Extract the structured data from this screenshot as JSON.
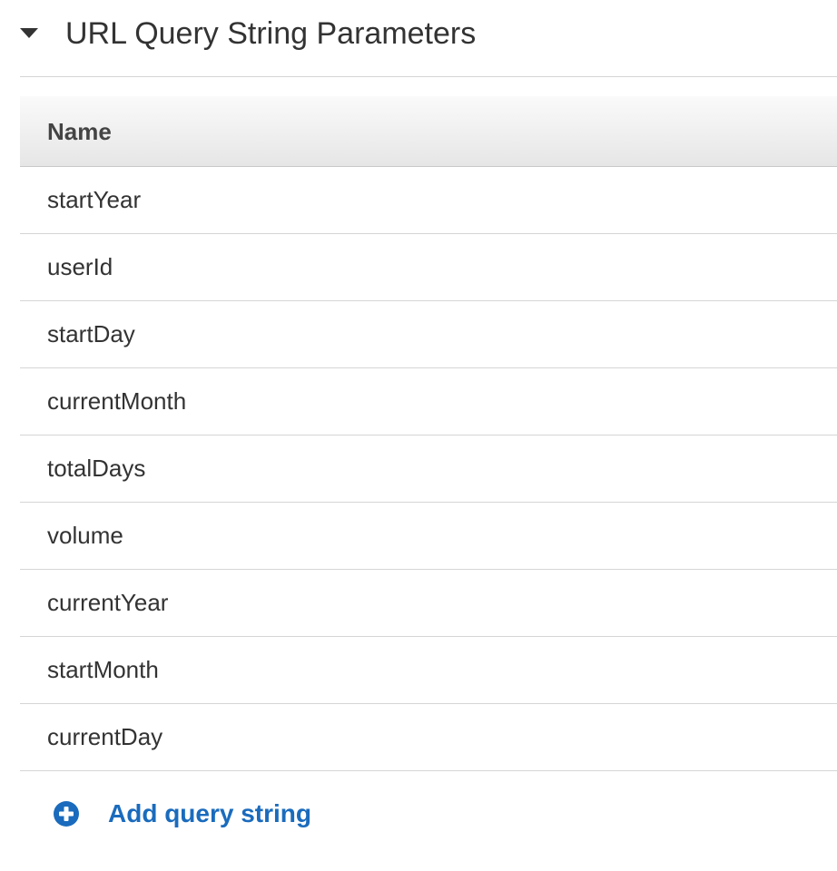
{
  "section": {
    "title": "URL Query String Parameters",
    "expanded": true,
    "caret_icon": "caret-down-icon"
  },
  "table": {
    "columns": [
      "Name"
    ],
    "rows": [
      "startYear",
      "userId",
      "startDay",
      "currentMonth",
      "totalDays",
      "volume",
      "currentYear",
      "startMonth",
      "currentDay"
    ]
  },
  "add_action": {
    "label": "Add query string",
    "icon": "plus-circle-icon",
    "color": "#1a6bbd"
  }
}
